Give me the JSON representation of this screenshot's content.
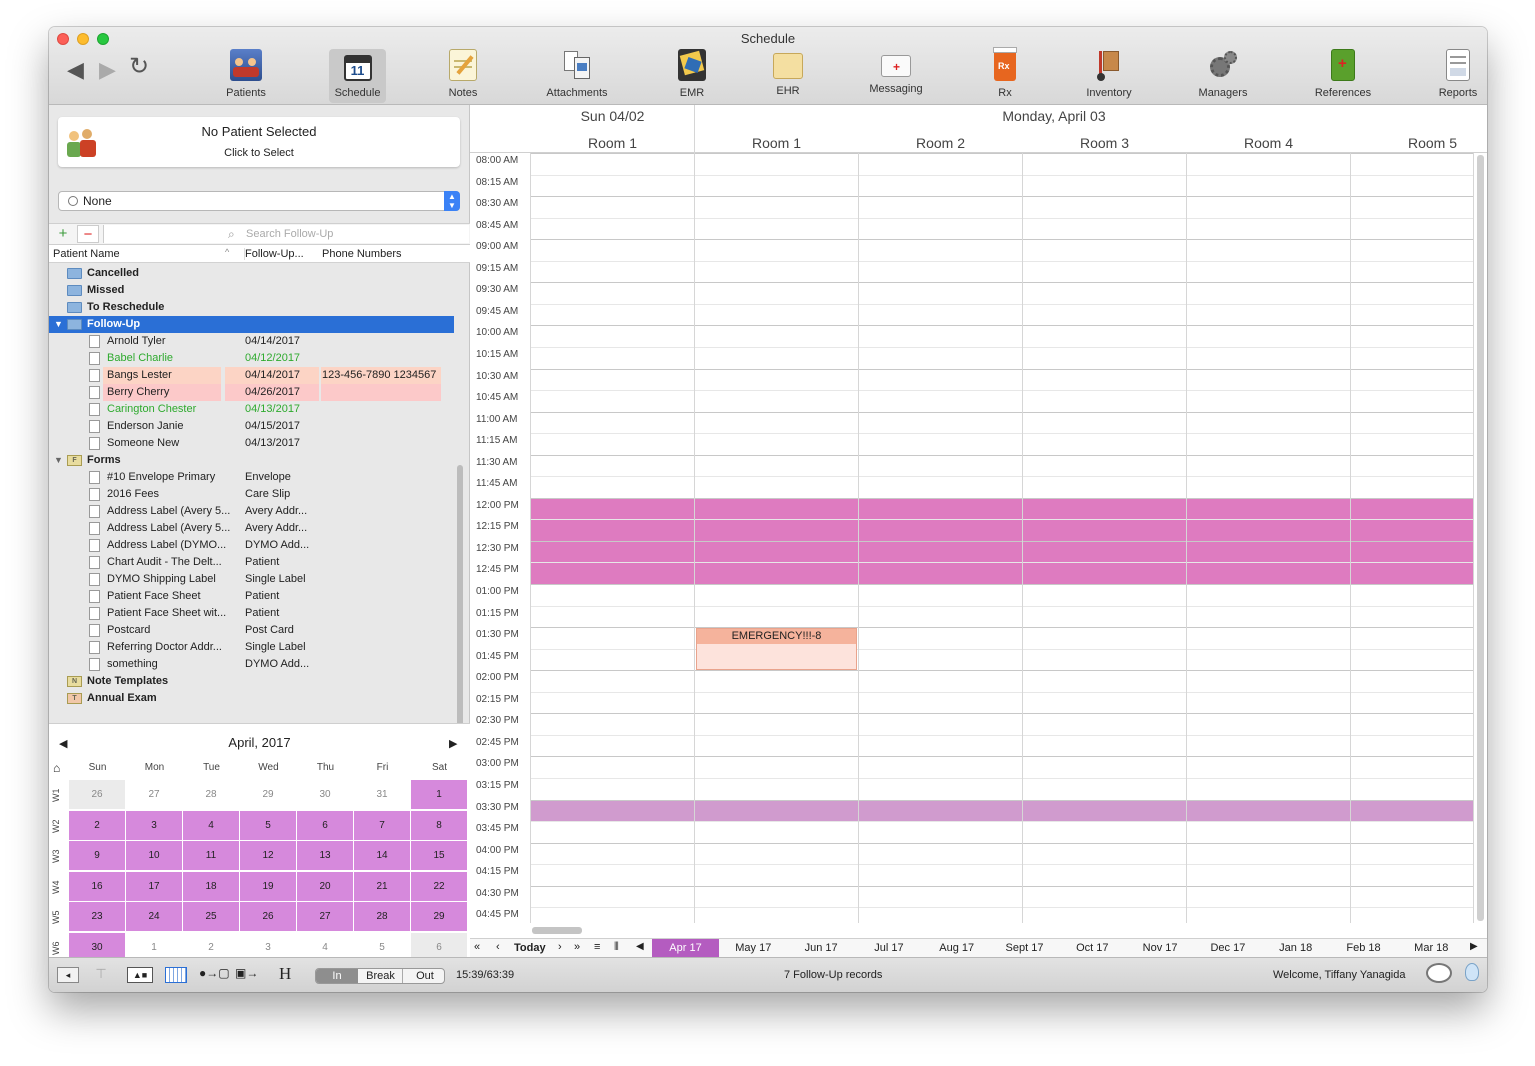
{
  "window": {
    "title": "Schedule"
  },
  "toolbar": {
    "items": [
      {
        "label": "Patients",
        "icon": "patients-icon"
      },
      {
        "label": "Schedule",
        "icon": "calendar-icon"
      },
      {
        "label": "Notes",
        "icon": "notes-icon"
      },
      {
        "label": "Attachments",
        "icon": "attachments-icon"
      },
      {
        "label": "EMR",
        "icon": "emr-icon"
      },
      {
        "label": "EHR",
        "icon": "ehr-folder-icon"
      },
      {
        "label": "Messaging",
        "icon": "envelope-icon"
      },
      {
        "label": "Rx",
        "icon": "rx-bottle-icon"
      },
      {
        "label": "Inventory",
        "icon": "hand-truck-icon"
      },
      {
        "label": "Managers",
        "icon": "gears-icon"
      },
      {
        "label": "References",
        "icon": "book-icon"
      },
      {
        "label": "Reports",
        "icon": "report-icon"
      }
    ],
    "schedule_icon_day": "11"
  },
  "patient_panel": {
    "title": "No Patient Selected",
    "subtitle": "Click to Select"
  },
  "selector": {
    "value": "None"
  },
  "search": {
    "placeholder": "Search Follow-Up"
  },
  "columns": {
    "name": "Patient Name",
    "followup": "Follow-Up...",
    "phone": "Phone Numbers"
  },
  "tree": {
    "groups_top": [
      "Cancelled",
      "Missed",
      "To Reschedule"
    ],
    "followup_label": "Follow-Up",
    "followups": [
      {
        "name": "Arnold Tyler",
        "date": "04/14/2017",
        "phone": "",
        "style": "normal"
      },
      {
        "name": "Babel Charlie",
        "date": "04/12/2017",
        "phone": "",
        "style": "green"
      },
      {
        "name": "Bangs Lester",
        "date": "04/14/2017",
        "phone": "123-456-7890 1234567",
        "style": "salmon"
      },
      {
        "name": "Berry Cherry",
        "date": "04/26/2017",
        "phone": "",
        "style": "pink"
      },
      {
        "name": "Carington Chester",
        "date": "04/13/2017",
        "phone": "",
        "style": "green"
      },
      {
        "name": "Enderson Janie",
        "date": "04/15/2017",
        "phone": "",
        "style": "normal"
      },
      {
        "name": "Someone New",
        "date": "04/13/2017",
        "phone": "",
        "style": "normal"
      }
    ],
    "forms_label": "Forms",
    "forms": [
      {
        "name": "#10 Envelope Primary",
        "type": "Envelope"
      },
      {
        "name": "2016 Fees",
        "type": "Care Slip"
      },
      {
        "name": "Address Label (Avery 5...",
        "type": "Avery Addr..."
      },
      {
        "name": "Address Label (Avery 5...",
        "type": "Avery Addr..."
      },
      {
        "name": "Address Label (DYMO...",
        "type": "DYMO Add..."
      },
      {
        "name": "Chart Audit - The Delt...",
        "type": "Patient"
      },
      {
        "name": "DYMO Shipping Label",
        "type": "Single Label"
      },
      {
        "name": "Patient Face Sheet",
        "type": "Patient"
      },
      {
        "name": "Patient Face Sheet wit...",
        "type": "Patient"
      },
      {
        "name": "Postcard",
        "type": "Post Card"
      },
      {
        "name": "Referring Doctor Addr...",
        "type": "Single Label"
      },
      {
        "name": "something",
        "type": "DYMO Add..."
      }
    ],
    "note_templates_label": "Note Templates",
    "annual_exam_label": "Annual Exam"
  },
  "mini_calendar": {
    "title": "April, 2017",
    "prev": "◀",
    "next": "▶",
    "days": [
      "Sun",
      "Mon",
      "Tue",
      "Wed",
      "Thu",
      "Fri",
      "Sat"
    ],
    "weeks": [
      {
        "label": "W1",
        "dates": [
          "26",
          "27",
          "28",
          "29",
          "30",
          "31",
          "1"
        ]
      },
      {
        "label": "W2",
        "dates": [
          "2",
          "3",
          "4",
          "5",
          "6",
          "7",
          "8"
        ]
      },
      {
        "label": "W3",
        "dates": [
          "9",
          "10",
          "11",
          "12",
          "13",
          "14",
          "15"
        ]
      },
      {
        "label": "W4",
        "dates": [
          "16",
          "17",
          "18",
          "19",
          "20",
          "21",
          "22"
        ]
      },
      {
        "label": "W5",
        "dates": [
          "23",
          "24",
          "25",
          "26",
          "27",
          "28",
          "29"
        ]
      },
      {
        "label": "W6",
        "dates": [
          "30",
          "1",
          "2",
          "3",
          "4",
          "5",
          "6"
        ]
      }
    ]
  },
  "schedule": {
    "day1": "Sun 04/02",
    "day2": "Monday, April 03",
    "rooms": [
      "Room 1",
      "Room 1",
      "Room 2",
      "Room 3",
      "Room 4",
      "Room 5"
    ],
    "times": [
      "08:00 AM",
      "08:15 AM",
      "08:30 AM",
      "08:45 AM",
      "09:00 AM",
      "09:15 AM",
      "09:30 AM",
      "09:45 AM",
      "10:00 AM",
      "10:15 AM",
      "10:30 AM",
      "10:45 AM",
      "11:00 AM",
      "11:15 AM",
      "11:30 AM",
      "11:45 AM",
      "12:00 PM",
      "12:15 PM",
      "12:30 PM",
      "12:45 PM",
      "01:00 PM",
      "01:15 PM",
      "01:30 PM",
      "01:45 PM",
      "02:00 PM",
      "02:15 PM",
      "02:30 PM",
      "02:45 PM",
      "03:00 PM",
      "03:15 PM",
      "03:30 PM",
      "03:45 PM",
      "04:00 PM",
      "04:15 PM",
      "04:30 PM",
      "04:45 PM"
    ],
    "appointment": {
      "label": "EMERGENCY!!!-8",
      "room": "Room 1",
      "start": "01:30 PM"
    },
    "blocked": [
      {
        "start": "12:00 PM",
        "end": "01:00 PM",
        "color": "#de7bc0"
      },
      {
        "start": "03:30 PM",
        "end": "03:45 PM",
        "color": "#d09bce"
      }
    ]
  },
  "month_bar": {
    "today_label": "Today",
    "months": [
      "Apr 17",
      "May 17",
      "Jun 17",
      "Jul 17",
      "Aug 17",
      "Sept 17",
      "Oct 17",
      "Nov 17",
      "Dec 17",
      "Jan 18",
      "Feb 18",
      "Mar 18"
    ],
    "selected": "Apr 17"
  },
  "status": {
    "seg": [
      "In",
      "Break",
      "Out"
    ],
    "time": "15:39/63:39",
    "records": "7 Follow-Up records",
    "welcome": "Welcome, Tiffany Yanagida"
  },
  "colors": {
    "accent": "#2a6fd6",
    "purple": "#d689dc",
    "pink_block": "#de7bc0"
  }
}
